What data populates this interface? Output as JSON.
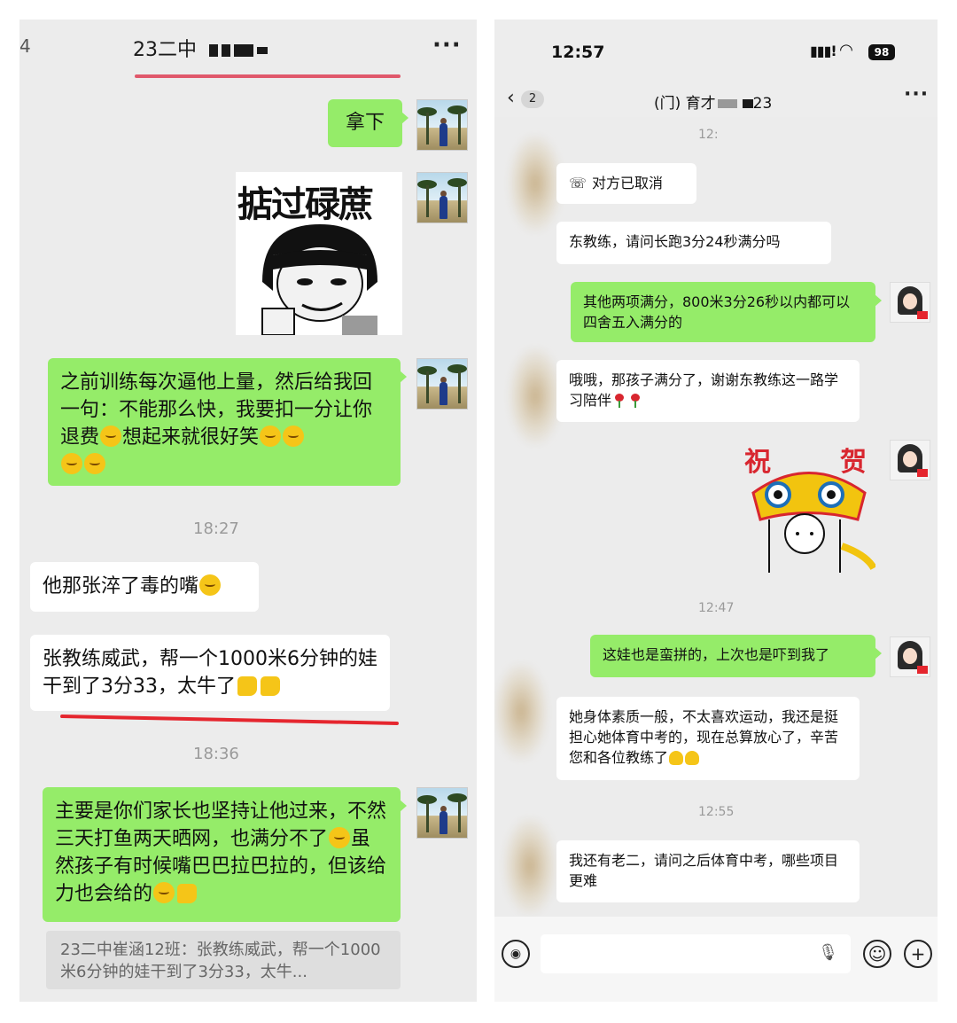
{
  "left": {
    "header": {
      "back_count": "4",
      "title": "23二中",
      "more": "···"
    },
    "messages": {
      "m1": "拿下",
      "m2_text": "之前训练每次逼他上量，然后给我回一句：不能那么快，我要扣一分让你退费",
      "m2_text2": "想起来就很好笑",
      "time1": "18:27",
      "m3": "他那张淬了毒的嘴",
      "m4_text": "张教练威武，帮一个1000米6分钟的娃干到了3分33，太牛了",
      "time2": "18:36",
      "m5_text": "主要是你们家长也坚持让他过来，不然三天打鱼两天晒网，也满分不了",
      "m5_text2": "虽然孩子有时候嘴巴巴拉巴拉的，但该给力也会给的",
      "quote": "23二中崔涵12班：张教练威武，帮一个1000米6分钟的娃干到了3分33，太牛..."
    },
    "sticker_text": "掂过碌蔗"
  },
  "right": {
    "status": {
      "time": "12:57",
      "battery": "98"
    },
    "header": {
      "back_count": "2",
      "title_prefix": "(门) 育才",
      "title_suffix": "23",
      "more": "···"
    },
    "messages": {
      "time0": "12:",
      "call": "对方已取消",
      "r1": "东教练，请问长跑3分24秒满分吗",
      "r2": "其他两项满分，800米3分26秒以内都可以四舍五入满分的",
      "r3": "哦哦，那孩子满分了，谢谢东教练这一路学习陪伴",
      "sticker_chars": [
        "祝",
        "贺"
      ],
      "time1": "12:47",
      "r4": "这娃也是蛮拼的，上次也是吓到我了",
      "r5": "她身体素质一般，不太喜欢运动，我还是挺担心她体育中考的，现在总算放心了，辛苦您和各位教练了",
      "time2": "12:55",
      "r6": "我还有老二，请问之后体育中考，哪些项目更难"
    },
    "inputbar": {
      "voice_icon": "voice-icon",
      "emoji_icon": "emoji-icon",
      "plus_icon": "plus-icon"
    }
  },
  "colors": {
    "green_bubble": "#95ec69",
    "chat_bg": "#ececec",
    "underline": "#e5262e"
  }
}
